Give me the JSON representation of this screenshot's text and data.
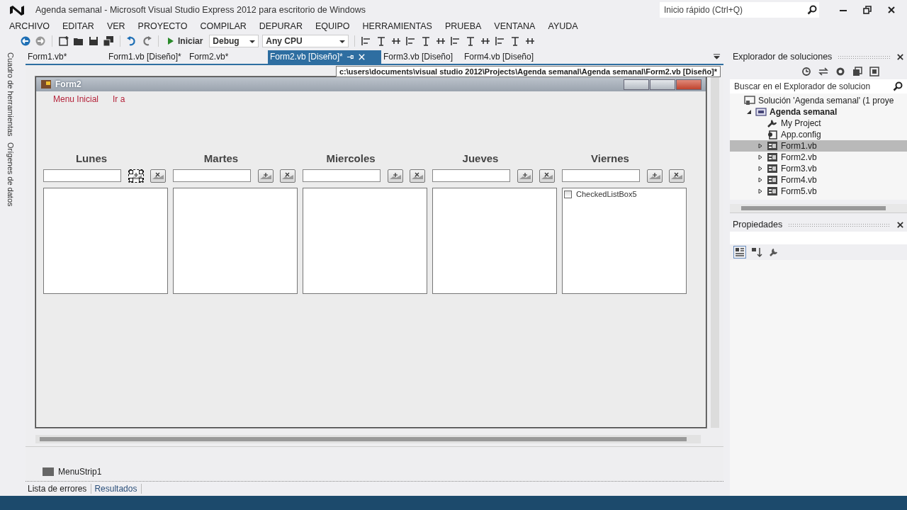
{
  "window": {
    "title": "Agenda semanal - Microsoft Visual Studio Express 2012 para escritorio de Windows",
    "quick_launch": {
      "placeholder": "Inicio rápido (Ctrl+Q)"
    }
  },
  "menu": [
    "ARCHIVO",
    "EDITAR",
    "VER",
    "PROYECTO",
    "COMPILAR",
    "DEPURAR",
    "EQUIPO",
    "HERRAMIENTAS",
    "PRUEBA",
    "VENTANA",
    "AYUDA"
  ],
  "toolbar": {
    "start": "Iniciar",
    "configuration": "Debug",
    "platform": "Any CPU"
  },
  "side_tabs": [
    "Cuadro de herramientas",
    "Orígenes de datos"
  ],
  "doc_tabs": [
    {
      "label": "Form1.vb*",
      "selected": false
    },
    {
      "label": "Form1.vb [Diseño]*",
      "selected": false
    },
    {
      "label": "Form2.vb*",
      "selected": false
    },
    {
      "label": "Form2.vb [Diseño]*",
      "selected": true
    },
    {
      "label": "Form3.vb [Diseño]",
      "selected": false
    },
    {
      "label": "Form4.vb [Diseño]",
      "selected": false
    }
  ],
  "tooltip": "c:\\users\\documents\\visual studio 2012\\Projects\\Agenda semanal\\Agenda semanal\\Form2.vb [Diseño]*",
  "form": {
    "title": "Form2",
    "menu": [
      "Menu Inicial",
      "Ir a"
    ],
    "days": [
      {
        "label": "Lunes",
        "add_selected": true
      },
      {
        "label": "Martes",
        "add_selected": false
      },
      {
        "label": "Miercoles",
        "add_selected": false
      },
      {
        "label": "Jueves",
        "add_selected": false
      },
      {
        "label": "Viernes",
        "add_selected": false,
        "list_text": "CheckedListBox5",
        "list_checked": false
      }
    ]
  },
  "tray": [
    "MenuStrip1"
  ],
  "output_tabs": [
    {
      "label": "Lista de errores",
      "selected": true
    },
    {
      "label": "Resultados",
      "selected": false
    }
  ],
  "solution_explorer": {
    "title": "Explorador de soluciones",
    "search": {
      "placeholder": "Buscar en el Explorador de solucion"
    },
    "tree": [
      {
        "label": "Solución 'Agenda semanal'  (1 proye",
        "kind": "solution",
        "selected": false,
        "children": [
          {
            "label": "Agenda semanal",
            "kind": "project",
            "bold": true,
            "expanded": true,
            "selected": false,
            "children": [
              {
                "label": "My Project",
                "kind": "wrench",
                "selected": false
              },
              {
                "label": "App.config",
                "kind": "config",
                "selected": false
              },
              {
                "label": "Form1.vb",
                "kind": "form",
                "expanded": false,
                "selected": true
              },
              {
                "label": "Form2.vb",
                "kind": "form",
                "expanded": false,
                "selected": false
              },
              {
                "label": "Form3.vb",
                "kind": "form",
                "expanded": false,
                "selected": false
              },
              {
                "label": "Form4.vb",
                "kind": "form",
                "expanded": false,
                "selected": false
              },
              {
                "label": "Form5.vb",
                "kind": "form",
                "expanded": false,
                "selected": false
              }
            ]
          }
        ]
      }
    ]
  },
  "properties": {
    "title": "Propiedades"
  }
}
